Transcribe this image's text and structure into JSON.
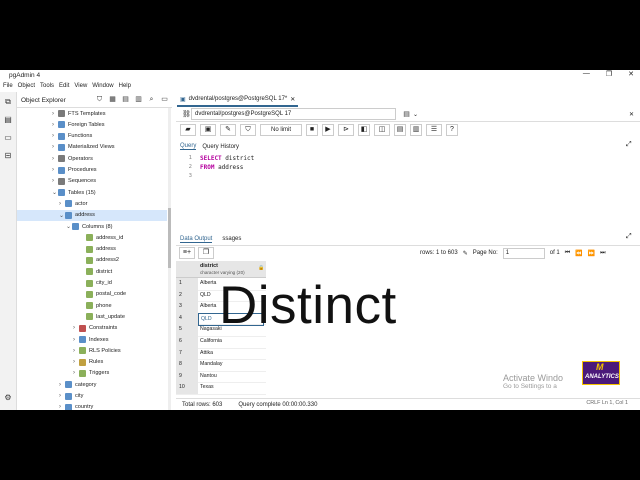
{
  "window": {
    "title": "pgAdmin 4",
    "controls": [
      "—",
      "❐",
      "✕"
    ]
  },
  "menu": [
    "File",
    "Object",
    "Tools",
    "Edit",
    "View",
    "Window",
    "Help"
  ],
  "explorer": {
    "title": "Object Explorer",
    "nodes": [
      {
        "label": "FTS Templates",
        "color": "#7a7a7a",
        "expanded": false
      },
      {
        "label": "Foreign Tables",
        "color": "#5a8fc8",
        "expanded": false
      },
      {
        "label": "Functions",
        "color": "#5a8fc8",
        "expanded": false
      },
      {
        "label": "Materialized Views",
        "color": "#5a8fc8",
        "expanded": false
      },
      {
        "label": "Operators",
        "color": "#7a7a7a",
        "expanded": false
      },
      {
        "label": "Procedures",
        "color": "#5a8fc8",
        "expanded": false
      },
      {
        "label": "Sequences",
        "color": "#7a7a7a",
        "expanded": false
      },
      {
        "label": "Tables (15)",
        "color": "#5a8fc8",
        "expanded": true
      },
      {
        "label": "actor",
        "color": "#5a8fc8",
        "expanded": false
      },
      {
        "label": "address",
        "color": "#5a8fc8",
        "expanded": true
      },
      {
        "label": "Columns (8)",
        "color": "#5a8fc8",
        "expanded": true
      },
      {
        "label": "address_id",
        "color": "#8bb05a"
      },
      {
        "label": "address",
        "color": "#8bb05a"
      },
      {
        "label": "address2",
        "color": "#8bb05a"
      },
      {
        "label": "district",
        "color": "#8bb05a"
      },
      {
        "label": "city_id",
        "color": "#8bb05a"
      },
      {
        "label": "postal_code",
        "color": "#8bb05a"
      },
      {
        "label": "phone",
        "color": "#8bb05a"
      },
      {
        "label": "last_update",
        "color": "#8bb05a"
      },
      {
        "label": "Constraints",
        "color": "#c05050",
        "expanded": false
      },
      {
        "label": "Indexes",
        "color": "#5a8fc8",
        "expanded": false
      },
      {
        "label": "RLS Policies",
        "color": "#8bb05a",
        "expanded": false
      },
      {
        "label": "Rules",
        "color": "#c0a040",
        "expanded": false
      },
      {
        "label": "Triggers",
        "color": "#8bb05a",
        "expanded": false
      },
      {
        "label": "category",
        "color": "#5a8fc8",
        "expanded": false
      },
      {
        "label": "city",
        "color": "#5a8fc8",
        "expanded": false
      },
      {
        "label": "country",
        "color": "#5a8fc8",
        "expanded": false
      }
    ]
  },
  "editor_tab": {
    "label": "dvdrental/postgres@PostgreSQL 17*"
  },
  "connection": {
    "value": "dvdrental/postgres@PostgreSQL 17"
  },
  "toolbar": {
    "limit": "No limit"
  },
  "query_tabs": [
    "Query",
    "Query History"
  ],
  "sql": {
    "line_numbers": [
      "1",
      "2",
      "3"
    ],
    "lines": [
      {
        "kw": "SELECT",
        "rest": " district"
      },
      {
        "kw": "FROM",
        "rest": " address"
      },
      {
        "kw": "",
        "rest": ""
      }
    ]
  },
  "output_tabs": [
    "Data Output",
    "ssages"
  ],
  "results": {
    "rows_info": "rows: 1 to 603",
    "page_label": "Page No:",
    "page_value": "1",
    "of": "of 1",
    "column_name": "district",
    "column_type": "character varying (20)",
    "rows": [
      {
        "n": "1",
        "v": "Alberta"
      },
      {
        "n": "2",
        "v": "QLD"
      },
      {
        "n": "3",
        "v": "Alberta"
      },
      {
        "n": "4",
        "v": "QLD"
      },
      {
        "n": "5",
        "v": "Nagasaki"
      },
      {
        "n": "6",
        "v": "California"
      },
      {
        "n": "7",
        "v": "Attika"
      },
      {
        "n": "8",
        "v": "Mandalay"
      },
      {
        "n": "9",
        "v": "Nantou"
      },
      {
        "n": "10",
        "v": "Texas"
      }
    ]
  },
  "status": {
    "total_rows": "Total rows: 603",
    "complete": "Query complete 00:00:00.330",
    "right": "CRLF   Ln 1, Col 1"
  },
  "watermark": {
    "line1": "Activate Windo",
    "line2": "Go to Settings to a"
  },
  "logo": {
    "letter": "M",
    "text": "ANALYTICS"
  },
  "overlay_title": "Distinct"
}
